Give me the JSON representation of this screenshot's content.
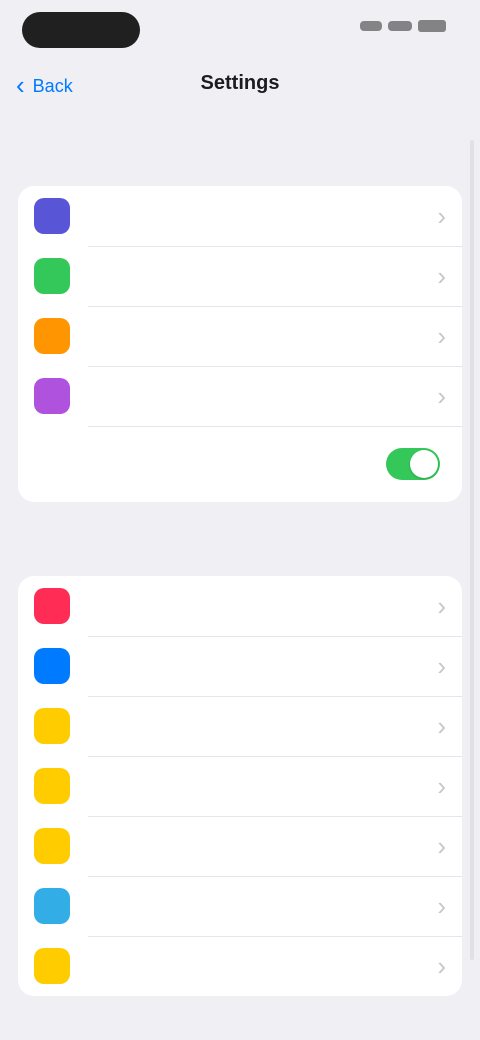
{
  "colors": {
    "background": "#efeff4",
    "card": "#ffffff",
    "chevron": "#c7c7cc",
    "toggle_on": "#34c759",
    "icons": [
      "#5856d6",
      "#34c759",
      "#ff9500",
      "#af52de",
      "#ff2d55",
      "#007aff",
      "#ffcc00",
      "#ffcc00",
      "#ffcc00",
      "#32ade6",
      "#ffcc00"
    ]
  },
  "nav": {
    "back_label": "Back",
    "title": "Settings"
  },
  "sections": [
    {
      "title": "",
      "rows": [
        {
          "label": "",
          "icon": "app-icon"
        },
        {
          "label": "",
          "icon": "app-icon"
        },
        {
          "label": "",
          "icon": "app-icon"
        },
        {
          "label": "",
          "icon": "app-icon"
        }
      ],
      "toggle": {
        "label": "",
        "on": true
      }
    },
    {
      "title": "",
      "rows": [
        {
          "label": "",
          "icon": "app-icon"
        },
        {
          "label": "",
          "icon": "app-icon"
        },
        {
          "label": "",
          "icon": "app-icon"
        },
        {
          "label": "",
          "icon": "app-icon"
        },
        {
          "label": "",
          "icon": "app-icon"
        },
        {
          "label": "",
          "icon": "app-icon"
        },
        {
          "label": "",
          "icon": "app-icon"
        }
      ]
    }
  ]
}
